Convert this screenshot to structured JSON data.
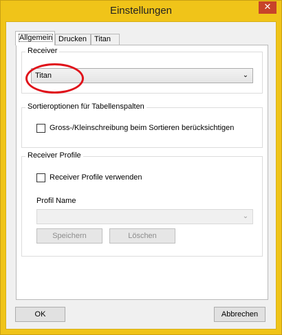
{
  "window": {
    "title": "Einstellungen",
    "close_glyph": "✕"
  },
  "tabs": [
    {
      "label": "Allgemein",
      "active": true
    },
    {
      "label": "Drucken",
      "active": false
    },
    {
      "label": "Titan",
      "active": false
    }
  ],
  "receiver": {
    "group_label": "Receiver",
    "selected": "Titan"
  },
  "sort_options": {
    "group_label": "Sortieroptionen für Tabellenspalten",
    "case_sensitive_label": "Gross-/Kleinschreibung beim Sortieren berücksichtigen",
    "case_sensitive_checked": false
  },
  "profiles": {
    "group_label": "Receiver Profile",
    "use_profiles_label": "Receiver Profile verwenden",
    "use_profiles_checked": false,
    "profile_name_label": "Profil Name",
    "profile_name_value": "",
    "save_label": "Speichern",
    "delete_label": "Löschen"
  },
  "footer": {
    "ok_label": "OK",
    "cancel_label": "Abbrechen"
  },
  "annotation": {
    "color": "#e0121a",
    "shape": "ellipse"
  },
  "icons": {
    "dropdown": "chevron-down-icon",
    "close": "close-icon"
  },
  "colors": {
    "title_bar": "#f0c419",
    "close_button": "#c7432a"
  }
}
